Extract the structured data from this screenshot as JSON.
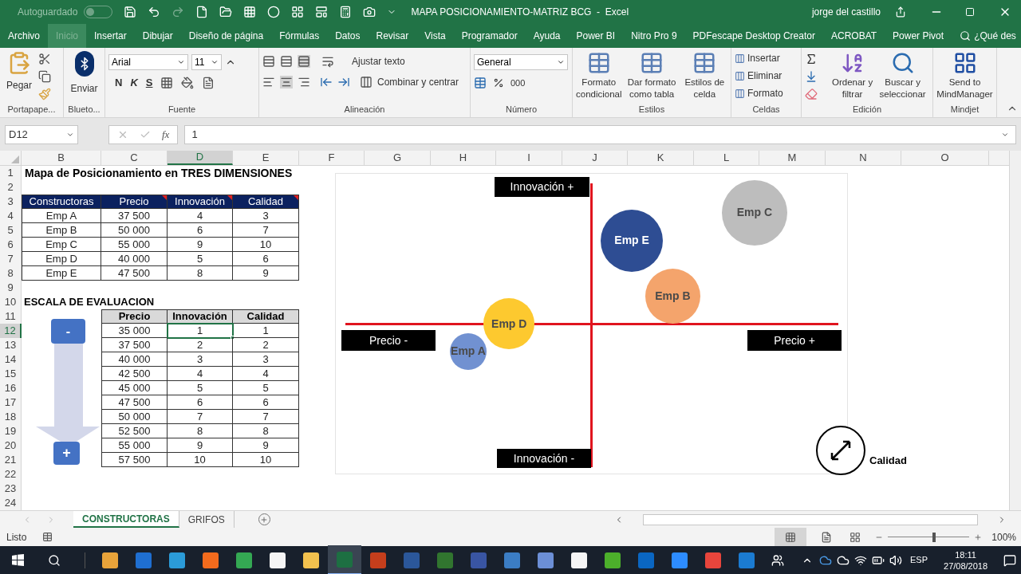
{
  "title_bar": {
    "autosave_label": "Autoguardado",
    "autosave_on": false,
    "title": "MAPA POSICIONAMIENTO-MATRIZ BCG  -  Excel",
    "user": "jorge del castillo"
  },
  "menu_tabs": [
    {
      "label": "Archivo",
      "selected": false
    },
    {
      "label": "Inicio",
      "selected": true
    },
    {
      "label": "Insertar",
      "selected": false
    },
    {
      "label": "Dibujar",
      "selected": false
    },
    {
      "label": "Diseño de página",
      "selected": false
    },
    {
      "label": "Fórmulas",
      "selected": false
    },
    {
      "label": "Datos",
      "selected": false
    },
    {
      "label": "Revisar",
      "selected": false
    },
    {
      "label": "Vista",
      "selected": false
    },
    {
      "label": "Programador",
      "selected": false
    },
    {
      "label": "Ayuda",
      "selected": false
    },
    {
      "label": "Power BI",
      "selected": false
    },
    {
      "label": "Nitro Pro 9",
      "selected": false
    },
    {
      "label": "PDFescape Desktop Creator",
      "selected": false
    },
    {
      "label": "ACROBAT",
      "selected": false
    },
    {
      "label": "Power Pivot",
      "selected": false
    }
  ],
  "tell_me": "¿Qué des",
  "ribbon": {
    "clipboard": {
      "paste": "Pegar",
      "label": "Portapape..."
    },
    "bluetooth": {
      "send": "Enviar",
      "label": "Blueto..."
    },
    "font": {
      "name": "Arial",
      "size": "11",
      "bold": "N",
      "italic": "K",
      "underline": "S",
      "label": "Fuente"
    },
    "alignment": {
      "wrap": "Ajustar texto",
      "merge": "Combinar y centrar",
      "label": "Alineación"
    },
    "number": {
      "format": "General",
      "thousands": "000",
      "label": "Número"
    },
    "styles": {
      "items": [
        [
          "Formato",
          "condicional"
        ],
        [
          "Dar formato",
          "como tabla"
        ],
        [
          "Estilos de",
          "celda"
        ]
      ],
      "label": "Estilos"
    },
    "cells": {
      "items": [
        "Insertar",
        "Eliminar",
        "Formato"
      ],
      "label": "Celdas"
    },
    "editing": {
      "items": [
        [
          "Ordenar y",
          "filtrar"
        ],
        [
          "Buscar y",
          "seleccionar"
        ]
      ],
      "label": "Edición"
    },
    "mindjet": {
      "item": [
        "Send to",
        "MindManager"
      ],
      "label": "Mindjet"
    }
  },
  "formula_bar": {
    "name_box": "D12",
    "function_label": "fx",
    "formula": "1"
  },
  "sheet": {
    "columns": [
      {
        "label": "B",
        "selected": false
      },
      {
        "label": "C",
        "selected": false
      },
      {
        "label": "D",
        "selected": true
      },
      {
        "label": "E",
        "selected": false
      },
      {
        "label": "F",
        "selected": false
      },
      {
        "label": "G",
        "selected": false
      },
      {
        "label": "H",
        "selected": false
      },
      {
        "label": "I",
        "selected": false
      },
      {
        "label": "J",
        "selected": false
      },
      {
        "label": "K",
        "selected": false
      },
      {
        "label": "L",
        "selected": false
      },
      {
        "label": "M",
        "selected": false
      },
      {
        "label": "N",
        "selected": false
      },
      {
        "label": "O",
        "selected": false
      }
    ],
    "rows": [
      {
        "label": "1",
        "selected": false
      },
      {
        "label": "2",
        "selected": false
      },
      {
        "label": "3",
        "selected": false
      },
      {
        "label": "4",
        "selected": false
      },
      {
        "label": "5",
        "selected": false
      },
      {
        "label": "6",
        "selected": false
      },
      {
        "label": "7",
        "selected": false
      },
      {
        "label": "8",
        "selected": false
      },
      {
        "label": "9",
        "selected": false
      },
      {
        "label": "10",
        "selected": false
      },
      {
        "label": "11",
        "selected": false
      },
      {
        "label": "12",
        "selected": true
      },
      {
        "label": "13",
        "selected": false
      },
      {
        "label": "14",
        "selected": false
      },
      {
        "label": "15",
        "selected": false
      },
      {
        "label": "16",
        "selected": false
      },
      {
        "label": "17",
        "selected": false
      },
      {
        "label": "18",
        "selected": false
      },
      {
        "label": "19",
        "selected": false
      },
      {
        "label": "20",
        "selected": false
      },
      {
        "label": "21",
        "selected": false
      },
      {
        "label": "22",
        "selected": false
      },
      {
        "label": "23",
        "selected": false
      },
      {
        "label": "24",
        "selected": false
      }
    ],
    "title": "Mapa de Posicionamiento en TRES DIMENSIONES",
    "table1": {
      "headers": [
        "Constructoras",
        "Precio",
        "Innovación",
        "Calidad"
      ],
      "rows": [
        [
          "Emp A",
          "37 500",
          "4",
          "3"
        ],
        [
          "Emp B",
          "50 000",
          "6",
          "7"
        ],
        [
          "Emp C",
          "55 000",
          "9",
          "10"
        ],
        [
          "Emp D",
          "40 000",
          "5",
          "6"
        ],
        [
          "Emp E",
          "47 500",
          "8",
          "9"
        ]
      ]
    },
    "scale_title": "ESCALA DE EVALUACION",
    "table2": {
      "headers": [
        "Precio",
        "Innovación",
        "Calidad"
      ],
      "rows": [
        [
          {
            "text": "35 000",
            "selected": false
          },
          {
            "text": "1",
            "selected": true
          },
          {
            "text": "1",
            "selected": false
          }
        ],
        [
          {
            "text": "37 500",
            "selected": false
          },
          {
            "text": "2",
            "selected": false
          },
          {
            "text": "2",
            "selected": false
          }
        ],
        [
          {
            "text": "40 000",
            "selected": false
          },
          {
            "text": "3",
            "selected": false
          },
          {
            "text": "3",
            "selected": false
          }
        ],
        [
          {
            "text": "42 500",
            "selected": false
          },
          {
            "text": "4",
            "selected": false
          },
          {
            "text": "4",
            "selected": false
          }
        ],
        [
          {
            "text": "45 000",
            "selected": false
          },
          {
            "text": "5",
            "selected": false
          },
          {
            "text": "5",
            "selected": false
          }
        ],
        [
          {
            "text": "47 500",
            "selected": false
          },
          {
            "text": "6",
            "selected": false
          },
          {
            "text": "6",
            "selected": false
          }
        ],
        [
          {
            "text": "50 000",
            "selected": false
          },
          {
            "text": "7",
            "selected": false
          },
          {
            "text": "7",
            "selected": false
          }
        ],
        [
          {
            "text": "52 500",
            "selected": false
          },
          {
            "text": "8",
            "selected": false
          },
          {
            "text": "8",
            "selected": false
          }
        ],
        [
          {
            "text": "55 000",
            "selected": false
          },
          {
            "text": "9",
            "selected": false
          },
          {
            "text": "9",
            "selected": false
          }
        ],
        [
          {
            "text": "57 500",
            "selected": false
          },
          {
            "text": "10",
            "selected": false
          },
          {
            "text": "10",
            "selected": false
          }
        ]
      ]
    },
    "spinner": {
      "minus": "-",
      "plus": "+"
    },
    "chart": {
      "top": "Innovación +",
      "bottom": "Innovación -",
      "left": "Precio -",
      "right": "Precio +",
      "legend": "Calidad",
      "bubbles": [
        {
          "label": "Emp A",
          "color": "#7191d1"
        },
        {
          "label": "Emp B",
          "color": "#f4a46c"
        },
        {
          "label": "Emp C",
          "color": "#bdbdbd"
        },
        {
          "label": "Emp D",
          "color": "#fdc92f"
        },
        {
          "label": "Emp E",
          "color": "#2e4d93"
        }
      ]
    }
  },
  "sheet_tabs": [
    {
      "label": "CONSTRUCTORAS",
      "selected": true
    },
    {
      "label": "GRIFOS",
      "selected": false
    }
  ],
  "status_bar": {
    "status": "Listo",
    "level": 0.57,
    "zoom": "100%"
  },
  "taskbar": {
    "language": "ESP",
    "time": "18:11",
    "date": "27/08/2018"
  }
}
